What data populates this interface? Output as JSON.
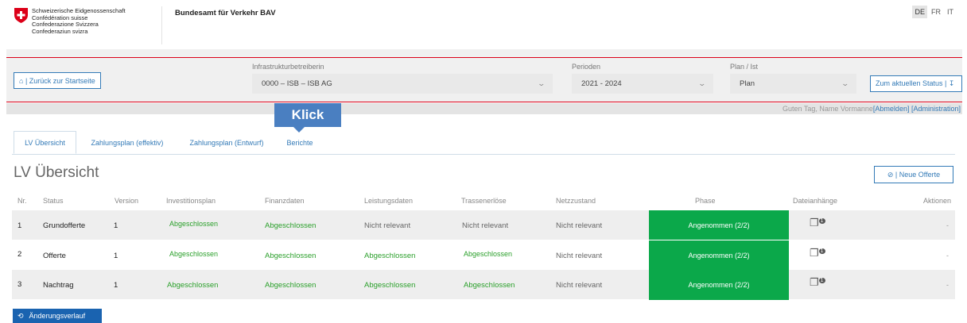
{
  "header": {
    "fed_lines": [
      "Schweizerische Eidgenossenschaft",
      "Confédération suisse",
      "Confederazione Svizzera",
      "Confederaziun svizra"
    ],
    "office": "Bundesamt für Verkehr BAV",
    "langs": [
      "DE",
      "FR",
      "IT"
    ],
    "active_lang": "DE"
  },
  "toolbar": {
    "back_icon": "home-icon",
    "back_label": " | Zurück zur Startseite",
    "infra_label": "Infrastrukturbetreiberin",
    "infra_value": "0000 – ISB – ISB AG",
    "perioden_label": "Perioden",
    "perioden_value": "2021 - 2024",
    "plan_label": "Plan / Ist",
    "plan_value": "Plan",
    "status_button": "Zum aktuellen Status | ↧"
  },
  "greeting": {
    "prefix": "Guten Tag, ",
    "name": "Name Vormanne",
    "logout": "[Abmelden]",
    "admin": "[Administration]"
  },
  "tooltip": "Klick",
  "tabs": [
    "LV Übersicht",
    "Zahlungsplan (effektiv)",
    "Zahlungsplan (Entwurf)",
    "Berichte"
  ],
  "page_title": "LV Übersicht",
  "new_offer": " | Neue Offerte",
  "table": {
    "headers": [
      "Nr.",
      "Status",
      "Version",
      "Investitionsplan",
      "Finanzdaten",
      "Leistungsdaten",
      "Trassenerlöse",
      "Netzzustand",
      "Phase",
      "Dateianhänge",
      "Aktionen"
    ],
    "rows": [
      {
        "nr": "1",
        "status": "Grundofferte",
        "version": "1",
        "invest": "Abgeschlossen",
        "finanz": "Abgeschlossen",
        "leistung": "Nicht relevant",
        "trassen": "Nicht relevant",
        "netz": "Nicht relevant",
        "phase": "Angenommen (2/2)",
        "attach_count": "1",
        "aktion": "-"
      },
      {
        "nr": "2",
        "status": "Offerte",
        "version": "1",
        "invest": "Abgeschlossen",
        "finanz": "Abgeschlossen",
        "leistung": "Abgeschlossen",
        "trassen": "Abgeschlossen",
        "netz": "Nicht relevant",
        "phase": "Angenommen (2/2)",
        "attach_count": "1",
        "aktion": "-"
      },
      {
        "nr": "3",
        "status": "Nachtrag",
        "version": "1",
        "invest": "Abgeschlossen",
        "finanz": "Abgeschlossen",
        "leistung": "Abgeschlossen",
        "trassen": "Abgeschlossen",
        "netz": "Nicht relevant",
        "phase": "Angenommen (2/2)",
        "attach_count": "1",
        "aktion": "-"
      }
    ]
  },
  "history_button": "Änderungsverlauf",
  "colors": {
    "swiss_red": "#dc0018",
    "accent": "#337ab7",
    "phase_green": "#0ba84a",
    "status_green": "#2ca02c"
  }
}
